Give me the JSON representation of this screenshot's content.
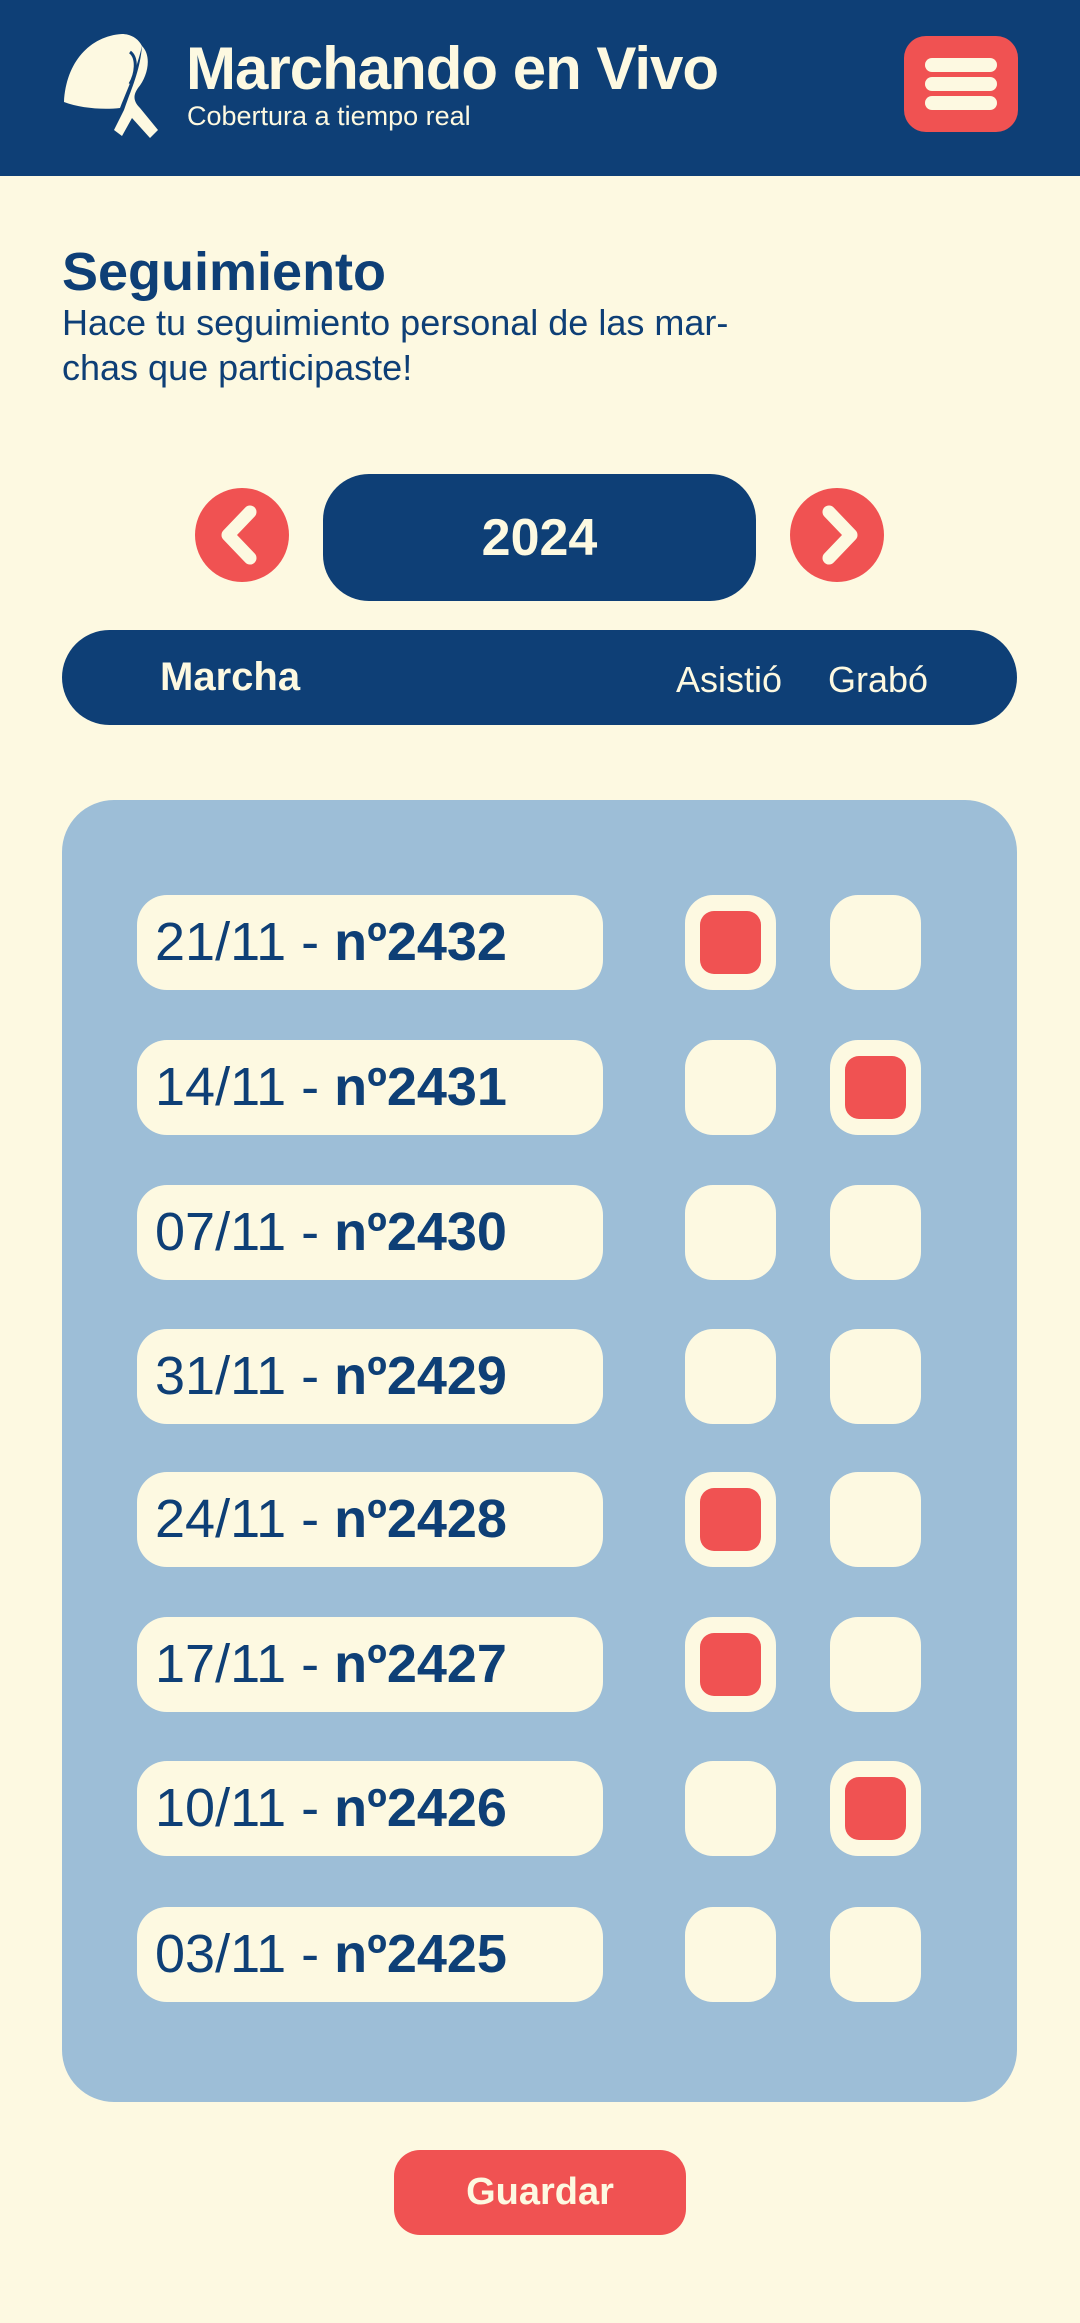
{
  "header": {
    "title": "Marchando en Vivo",
    "subtitle": "Cobertura a tiempo real",
    "logo_icon": "headscarf-logo-icon",
    "menu_icon": "hamburger-menu-icon"
  },
  "section": {
    "title": "Seguimiento",
    "description": "Hace tu seguimiento personal de las mar-\nchas que participaste!"
  },
  "year_nav": {
    "year": "2024",
    "prev_icon": "chevron-left-icon",
    "next_icon": "chevron-right-icon"
  },
  "table": {
    "col_marcha": "Marcha",
    "col_asistio": "Asistió",
    "col_grabo": "Grabó"
  },
  "rows": [
    {
      "date": "21/11 - ",
      "number": "nº2432",
      "asistio": true,
      "grabo": false
    },
    {
      "date": "14/11 - ",
      "number": "nº2431",
      "asistio": false,
      "grabo": true
    },
    {
      "date": "07/11 - ",
      "number": "nº2430",
      "asistio": false,
      "grabo": false
    },
    {
      "date": "31/11 - ",
      "number": "nº2429",
      "asistio": false,
      "grabo": false
    },
    {
      "date": "24/11 - ",
      "number": "nº2428",
      "asistio": true,
      "grabo": false
    },
    {
      "date": "17/11 - ",
      "number": "nº2427",
      "asistio": true,
      "grabo": false
    },
    {
      "date": "10/11 - ",
      "number": "nº2426",
      "asistio": false,
      "grabo": true
    },
    {
      "date": "03/11 - ",
      "number": "nº2425",
      "asistio": false,
      "grabo": false
    }
  ],
  "save_label": "Guardar",
  "colors": {
    "primary": "#0e3f76",
    "accent": "#f05252",
    "background": "#fdf9e1",
    "panel": "#9dbed7"
  }
}
